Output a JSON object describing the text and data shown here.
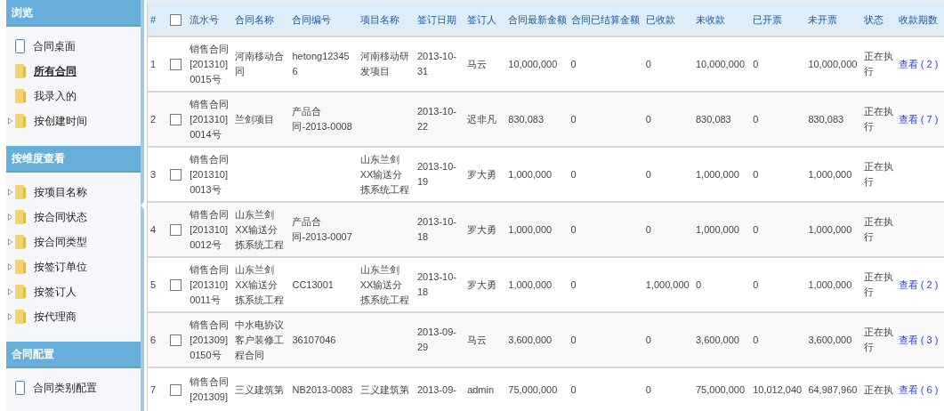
{
  "sidebar": {
    "sections": [
      {
        "title": "浏览",
        "items": [
          {
            "label": "合同桌面",
            "kind": "page",
            "expandable": false,
            "selected": false
          },
          {
            "label": "所有合同",
            "kind": "folder",
            "expandable": false,
            "selected": true
          },
          {
            "label": "我录入的",
            "kind": "folder",
            "expandable": false,
            "selected": false
          },
          {
            "label": "按创建时间",
            "kind": "folder",
            "expandable": true,
            "selected": false
          }
        ]
      },
      {
        "title": "按维度查看",
        "items": [
          {
            "label": "按项目名称",
            "kind": "folder",
            "expandable": true,
            "selected": false
          },
          {
            "label": "按合同状态",
            "kind": "folder",
            "expandable": true,
            "selected": false
          },
          {
            "label": "按合同类型",
            "kind": "folder",
            "expandable": true,
            "selected": false
          },
          {
            "label": "按签订单位",
            "kind": "folder",
            "expandable": true,
            "selected": false
          },
          {
            "label": "按签订人",
            "kind": "folder",
            "expandable": true,
            "selected": false
          },
          {
            "label": "按代理商",
            "kind": "folder",
            "expandable": true,
            "selected": false
          }
        ]
      },
      {
        "title": "合同配置",
        "items": [
          {
            "label": "合同类别配置",
            "kind": "page",
            "expandable": false,
            "selected": false
          }
        ]
      }
    ]
  },
  "table": {
    "columns": [
      "#",
      "流水号",
      "合同名称",
      "合同编号",
      "项目名称",
      "签订日期",
      "签订人",
      "合同最新金额",
      "合同已结算金额",
      "已收款",
      "未收款",
      "已开票",
      "未开票",
      "状态",
      "收款期数"
    ],
    "header_checked": false,
    "rows": [
      {
        "cells": [
          "1",
          "销售合同[201310]0015号",
          "河南移动合同",
          "hetong123456",
          "河南移动研发项目",
          "2013-10-31",
          "马云",
          "10,000,000",
          "0",
          "0",
          "10,000,000",
          "0",
          "10,000,000",
          "正在执行",
          "查看 ( 2 )"
        ],
        "checked": false
      },
      {
        "cells": [
          "2",
          "销售合同[201310]0014号",
          "兰剑项目",
          "产品合同-2013-0008",
          "",
          "2013-10-22",
          "迟非凡",
          "830,083",
          "0",
          "0",
          "830,083",
          "0",
          "830,083",
          "正在执行",
          "查看 ( 7 )"
        ],
        "checked": false
      },
      {
        "cells": [
          "3",
          "销售合同[201310]0013号",
          "",
          "",
          "山东兰剑XX输送分拣系统工程",
          "2013-10-19",
          "罗大勇",
          "1,000,000",
          "0",
          "0",
          "1,000,000",
          "0",
          "1,000,000",
          "正在执行",
          ""
        ],
        "checked": false
      },
      {
        "cells": [
          "4",
          "销售合同[201310]0012号",
          "山东兰剑XX输送分拣系统工程",
          "产品合同-2013-0007",
          "",
          "2013-10-18",
          "罗大勇",
          "1,000,000",
          "0",
          "0",
          "1,000,000",
          "0",
          "1,000,000",
          "正在执行",
          ""
        ],
        "checked": false
      },
      {
        "cells": [
          "5",
          "销售合同[201310]0011号",
          "山东兰剑XX输送分拣系统工程",
          "CC13001",
          "山东兰剑XX输送分拣系统工程",
          "2013-10-18",
          "罗大勇",
          "1,000,000",
          "0",
          "1,000,000",
          "0",
          "0",
          "1,000,000",
          "正在执行",
          "查看 ( 2 )"
        ],
        "checked": false
      },
      {
        "cells": [
          "6",
          "销售合同[201309]0150号",
          "中水电协议客户装修工程合同",
          "36107046",
          "",
          "2013-09-29",
          "马云",
          "3,600,000",
          "0",
          "0",
          "3,600,000",
          "0",
          "3,600,000",
          "正在执行",
          "查看 ( 3 )"
        ],
        "checked": false
      },
      {
        "cells": [
          "7",
          "销售合同[201309]",
          "三义建筑第",
          "NB2013-0083",
          "三义建筑第",
          "2013-09-",
          "admin",
          "75,000,000",
          "0",
          "0",
          "75,000,000",
          "10,012,040",
          "64,987,960",
          "正在执",
          "查看 ( 6 )"
        ],
        "checked": false
      }
    ]
  }
}
